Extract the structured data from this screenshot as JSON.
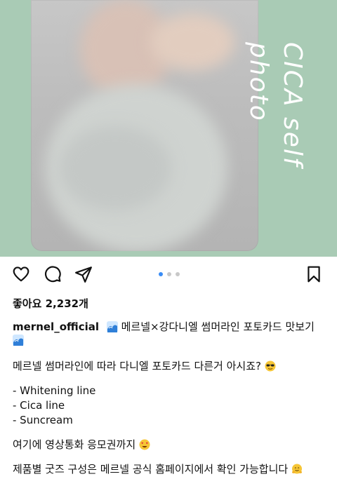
{
  "post": {
    "vertical_caption": "CICA self photo",
    "likes_text": "좋아요 2,232개",
    "username": "mernel_official",
    "title": "메르넬×강다니엘 썸머라인 포토카드 맛보기",
    "lines": [
      "메르넬 썸머라인에 따라 다니엘 포토카드 다른거 아시죠?",
      "",
      "- Whitening line",
      "- Cica line",
      "- Suncream",
      "",
      "여기에 영상통화 응모권까지",
      "",
      "제품별 굿즈 구성은 메르넬 공식 홈페이지에서 확인 가능합니다"
    ]
  },
  "carousel": {
    "current": 1,
    "total": 3
  },
  "icons": [
    "heart-icon",
    "comment-icon",
    "share-icon",
    "bookmark-icon",
    "wave-emoji",
    "sunglasses-emoji",
    "heart-eyes-emoji",
    "hug-emoji"
  ],
  "colors": {
    "background": "#ffffff",
    "mint": "#a9cbb5",
    "active_dot": "#3a8df6"
  }
}
